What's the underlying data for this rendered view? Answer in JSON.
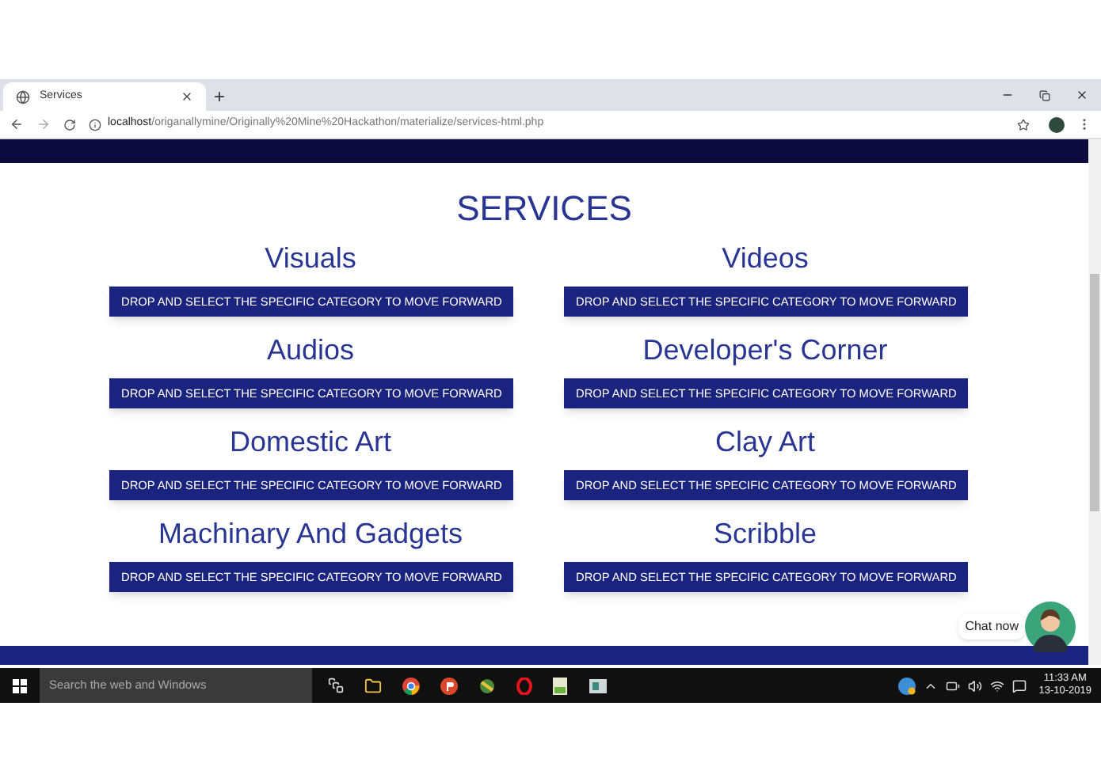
{
  "browser": {
    "tab_title": "Services",
    "new_tab": "+",
    "url_host": "localhost",
    "url_path": "/origanallymine/Originally%20Mine%20Hackathon/materialize/services-html.php"
  },
  "page": {
    "heading": "SERVICES",
    "services": [
      {
        "title": "Visuals",
        "dropdown": "DROP AND SELECT THE SPECIFIC CATEGORY TO MOVE FORWARD"
      },
      {
        "title": "Videos",
        "dropdown": "DROP AND SELECT THE SPECIFIC CATEGORY TO MOVE FORWARD"
      },
      {
        "title": "Audios",
        "dropdown": "DROP AND SELECT THE SPECIFIC CATEGORY TO MOVE FORWARD"
      },
      {
        "title": "Developer's Corner",
        "dropdown": "DROP AND SELECT THE SPECIFIC CATEGORY TO MOVE FORWARD"
      },
      {
        "title": "Domestic Art",
        "dropdown": "DROP AND SELECT THE SPECIFIC CATEGORY TO MOVE FORWARD"
      },
      {
        "title": "Clay Art",
        "dropdown": "DROP AND SELECT THE SPECIFIC CATEGORY TO MOVE FORWARD"
      },
      {
        "title": "Machinary And Gadgets",
        "dropdown": "DROP AND SELECT THE SPECIFIC CATEGORY TO MOVE FORWARD"
      },
      {
        "title": "Scribble",
        "dropdown": "DROP AND SELECT THE SPECIFIC CATEGORY TO MOVE FORWARD"
      }
    ],
    "chat": {
      "label": "Chat now"
    }
  },
  "taskbar": {
    "search_placeholder": "Search the web and Windows",
    "time": "11:33 AM",
    "date": "13-10-2019"
  }
}
